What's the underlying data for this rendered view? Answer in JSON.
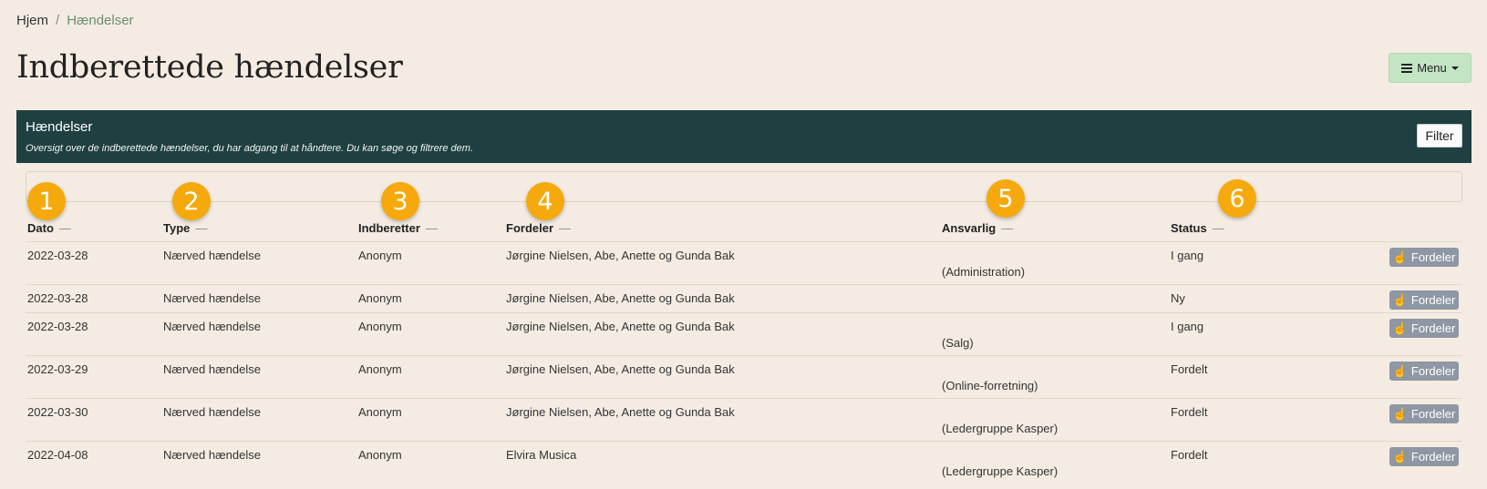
{
  "breadcrumb": {
    "home": "Hjem",
    "separator": "/",
    "current": "Hændelser"
  },
  "page_title": "Indberettede hændelser",
  "menu_button": {
    "label": "Menu",
    "icon": "list-icon"
  },
  "panel": {
    "title": "Hændelser",
    "description": "Oversigt over de indberettede hændelser, du har adgang til at håndtere. Du kan søge og filtrere dem.",
    "filter_label": "Filter"
  },
  "search": {
    "placeholder": "",
    "value": ""
  },
  "table": {
    "headers": {
      "dato": "Dato",
      "type": "Type",
      "indberetter": "Indberetter",
      "fordeler": "Fordeler",
      "ansvarlig": "Ansvarlig",
      "status": "Status"
    },
    "sort_symbol": "—",
    "action_label": "Fordeler",
    "rows": [
      {
        "dato": "2022-03-28",
        "type": "Nærved hændelse",
        "indberetter": "Anonym",
        "fordeler": "Jørgine Nielsen, Abe, Anette og Gunda Bak",
        "ansvarlig": "(Administration)",
        "status": "I gang"
      },
      {
        "dato": "2022-03-28",
        "type": "Nærved hændelse",
        "indberetter": "Anonym",
        "fordeler": "Jørgine Nielsen, Abe, Anette og Gunda Bak",
        "ansvarlig": "",
        "status": "Ny"
      },
      {
        "dato": "2022-03-28",
        "type": "Nærved hændelse",
        "indberetter": "Anonym",
        "fordeler": "Jørgine Nielsen, Abe, Anette og Gunda Bak",
        "ansvarlig": "(Salg)",
        "status": "I gang"
      },
      {
        "dato": "2022-03-29",
        "type": "Nærved hændelse",
        "indberetter": "Anonym",
        "fordeler": "Jørgine Nielsen, Abe, Anette og Gunda Bak",
        "ansvarlig": "(Online-forretning)",
        "status": "Fordelt"
      },
      {
        "dato": "2022-03-30",
        "type": "Nærved hændelse",
        "indberetter": "Anonym",
        "fordeler": "Jørgine Nielsen, Abe, Anette og Gunda Bak",
        "ansvarlig": "(Ledergruppe Kasper)",
        "status": "Fordelt"
      },
      {
        "dato": "2022-04-08",
        "type": "Nærved hændelse",
        "indberetter": "Anonym",
        "fordeler": "Elvira Musica",
        "ansvarlig": "(Ledergruppe Kasper)",
        "status": "Fordelt"
      }
    ]
  },
  "badges": [
    "1",
    "2",
    "3",
    "4",
    "5",
    "6"
  ],
  "colors": {
    "background": "#f4ece2",
    "header": "#1f4040",
    "menu_button": "#c3e5c4",
    "badge": "#f5a90c",
    "action_button": "#8e97a3"
  }
}
